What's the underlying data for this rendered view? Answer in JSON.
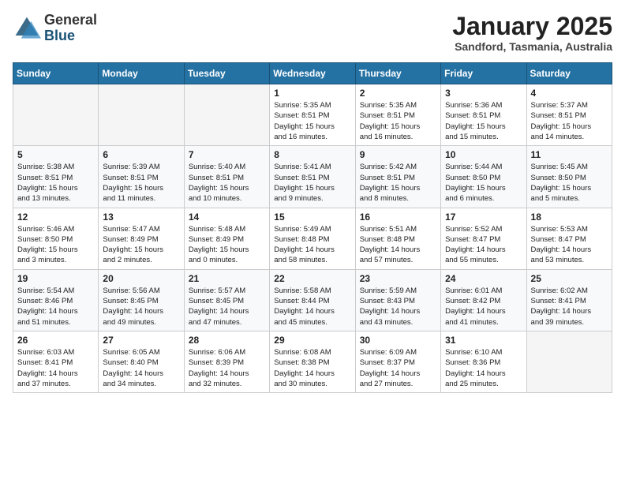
{
  "header": {
    "logo_line1": "General",
    "logo_line2": "Blue",
    "month": "January 2025",
    "location": "Sandford, Tasmania, Australia"
  },
  "days_of_week": [
    "Sunday",
    "Monday",
    "Tuesday",
    "Wednesday",
    "Thursday",
    "Friday",
    "Saturday"
  ],
  "weeks": [
    [
      {
        "day": "",
        "content": ""
      },
      {
        "day": "",
        "content": ""
      },
      {
        "day": "",
        "content": ""
      },
      {
        "day": "1",
        "content": "Sunrise: 5:35 AM\nSunset: 8:51 PM\nDaylight: 15 hours\nand 16 minutes."
      },
      {
        "day": "2",
        "content": "Sunrise: 5:35 AM\nSunset: 8:51 PM\nDaylight: 15 hours\nand 16 minutes."
      },
      {
        "day": "3",
        "content": "Sunrise: 5:36 AM\nSunset: 8:51 PM\nDaylight: 15 hours\nand 15 minutes."
      },
      {
        "day": "4",
        "content": "Sunrise: 5:37 AM\nSunset: 8:51 PM\nDaylight: 15 hours\nand 14 minutes."
      }
    ],
    [
      {
        "day": "5",
        "content": "Sunrise: 5:38 AM\nSunset: 8:51 PM\nDaylight: 15 hours\nand 13 minutes."
      },
      {
        "day": "6",
        "content": "Sunrise: 5:39 AM\nSunset: 8:51 PM\nDaylight: 15 hours\nand 11 minutes."
      },
      {
        "day": "7",
        "content": "Sunrise: 5:40 AM\nSunset: 8:51 PM\nDaylight: 15 hours\nand 10 minutes."
      },
      {
        "day": "8",
        "content": "Sunrise: 5:41 AM\nSunset: 8:51 PM\nDaylight: 15 hours\nand 9 minutes."
      },
      {
        "day": "9",
        "content": "Sunrise: 5:42 AM\nSunset: 8:51 PM\nDaylight: 15 hours\nand 8 minutes."
      },
      {
        "day": "10",
        "content": "Sunrise: 5:44 AM\nSunset: 8:50 PM\nDaylight: 15 hours\nand 6 minutes."
      },
      {
        "day": "11",
        "content": "Sunrise: 5:45 AM\nSunset: 8:50 PM\nDaylight: 15 hours\nand 5 minutes."
      }
    ],
    [
      {
        "day": "12",
        "content": "Sunrise: 5:46 AM\nSunset: 8:50 PM\nDaylight: 15 hours\nand 3 minutes."
      },
      {
        "day": "13",
        "content": "Sunrise: 5:47 AM\nSunset: 8:49 PM\nDaylight: 15 hours\nand 2 minutes."
      },
      {
        "day": "14",
        "content": "Sunrise: 5:48 AM\nSunset: 8:49 PM\nDaylight: 15 hours\nand 0 minutes."
      },
      {
        "day": "15",
        "content": "Sunrise: 5:49 AM\nSunset: 8:48 PM\nDaylight: 14 hours\nand 58 minutes."
      },
      {
        "day": "16",
        "content": "Sunrise: 5:51 AM\nSunset: 8:48 PM\nDaylight: 14 hours\nand 57 minutes."
      },
      {
        "day": "17",
        "content": "Sunrise: 5:52 AM\nSunset: 8:47 PM\nDaylight: 14 hours\nand 55 minutes."
      },
      {
        "day": "18",
        "content": "Sunrise: 5:53 AM\nSunset: 8:47 PM\nDaylight: 14 hours\nand 53 minutes."
      }
    ],
    [
      {
        "day": "19",
        "content": "Sunrise: 5:54 AM\nSunset: 8:46 PM\nDaylight: 14 hours\nand 51 minutes."
      },
      {
        "day": "20",
        "content": "Sunrise: 5:56 AM\nSunset: 8:45 PM\nDaylight: 14 hours\nand 49 minutes."
      },
      {
        "day": "21",
        "content": "Sunrise: 5:57 AM\nSunset: 8:45 PM\nDaylight: 14 hours\nand 47 minutes."
      },
      {
        "day": "22",
        "content": "Sunrise: 5:58 AM\nSunset: 8:44 PM\nDaylight: 14 hours\nand 45 minutes."
      },
      {
        "day": "23",
        "content": "Sunrise: 5:59 AM\nSunset: 8:43 PM\nDaylight: 14 hours\nand 43 minutes."
      },
      {
        "day": "24",
        "content": "Sunrise: 6:01 AM\nSunset: 8:42 PM\nDaylight: 14 hours\nand 41 minutes."
      },
      {
        "day": "25",
        "content": "Sunrise: 6:02 AM\nSunset: 8:41 PM\nDaylight: 14 hours\nand 39 minutes."
      }
    ],
    [
      {
        "day": "26",
        "content": "Sunrise: 6:03 AM\nSunset: 8:41 PM\nDaylight: 14 hours\nand 37 minutes."
      },
      {
        "day": "27",
        "content": "Sunrise: 6:05 AM\nSunset: 8:40 PM\nDaylight: 14 hours\nand 34 minutes."
      },
      {
        "day": "28",
        "content": "Sunrise: 6:06 AM\nSunset: 8:39 PM\nDaylight: 14 hours\nand 32 minutes."
      },
      {
        "day": "29",
        "content": "Sunrise: 6:08 AM\nSunset: 8:38 PM\nDaylight: 14 hours\nand 30 minutes."
      },
      {
        "day": "30",
        "content": "Sunrise: 6:09 AM\nSunset: 8:37 PM\nDaylight: 14 hours\nand 27 minutes."
      },
      {
        "day": "31",
        "content": "Sunrise: 6:10 AM\nSunset: 8:36 PM\nDaylight: 14 hours\nand 25 minutes."
      },
      {
        "day": "",
        "content": ""
      }
    ]
  ]
}
